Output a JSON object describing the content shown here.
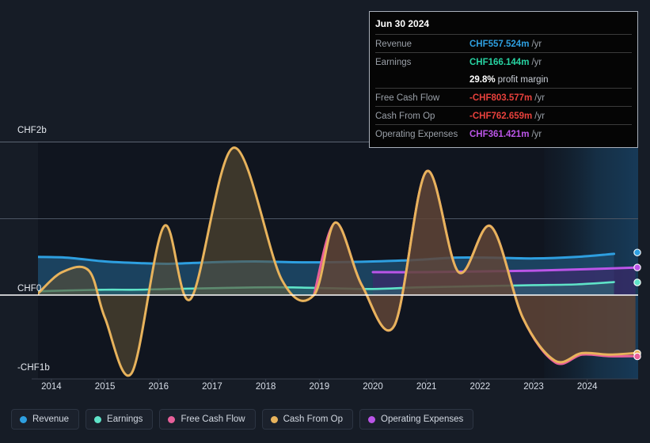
{
  "chart_data": {
    "type": "area",
    "title": "",
    "xlabel": "",
    "ylabel": "",
    "currency": "CHF",
    "grid": true,
    "legend_position": "bottom-left",
    "x_ticks": [
      "2014",
      "2015",
      "2016",
      "2017",
      "2018",
      "2019",
      "2020",
      "2021",
      "2022",
      "2023",
      "2024"
    ],
    "y_ticks": [
      "CHF2b",
      "CHF0",
      "-CHF1b"
    ],
    "ylim": [
      -1.1,
      2.1
    ],
    "y_tick_values": [
      2,
      0,
      -1
    ],
    "gridline_values": [
      2,
      1,
      0
    ],
    "zero_line": 0,
    "forecast_region": {
      "from": "2023.2",
      "to": "2024.9",
      "label": ""
    },
    "series": [
      {
        "name": "Revenue",
        "color": "#2e9fe0",
        "fill": "#1d4a6b",
        "x": [
          2013.75,
          2014.3,
          2015.0,
          2015.6,
          2016.2,
          2017.0,
          2017.8,
          2018.5,
          2019.2,
          2020.0,
          2020.8,
          2021.5,
          2022.2,
          2023.0,
          2023.8,
          2024.5
        ],
        "values": [
          0.5,
          0.49,
          0.44,
          0.42,
          0.41,
          0.43,
          0.44,
          0.43,
          0.43,
          0.44,
          0.46,
          0.49,
          0.49,
          0.48,
          0.5,
          0.54
        ]
      },
      {
        "name": "Earnings",
        "color": "#5fe3c8",
        "fill": "#2f6f75",
        "x": [
          2013.75,
          2014.3,
          2015.0,
          2015.6,
          2016.2,
          2017.0,
          2017.8,
          2018.5,
          2019.2,
          2020.0,
          2020.8,
          2021.5,
          2022.2,
          2023.0,
          2023.8,
          2024.5
        ],
        "values": [
          0.05,
          0.06,
          0.07,
          0.07,
          0.08,
          0.09,
          0.1,
          0.1,
          0.09,
          0.08,
          0.1,
          0.11,
          0.12,
          0.13,
          0.14,
          0.17
        ]
      },
      {
        "name": "Free Cash Flow",
        "color": "#e8609a",
        "fill": "#6b2f40",
        "x": [
          2018.9,
          2019.3,
          2019.8,
          2020.4,
          2021.0,
          2021.6,
          2022.2,
          2022.8,
          2023.4,
          2023.9,
          2024.4,
          2024.9
        ],
        "values": [
          0.0,
          0.95,
          0.12,
          -0.4,
          1.62,
          0.3,
          0.9,
          -0.3,
          -0.88,
          -0.78,
          -0.8,
          -0.8
        ]
      },
      {
        "name": "Cash From Op",
        "color": "#e8b35c",
        "fill": "#5c4e33",
        "x": [
          2013.75,
          2014.2,
          2014.7,
          2015.0,
          2015.5,
          2016.1,
          2016.6,
          2017.4,
          2018.3,
          2018.9,
          2019.3,
          2019.8,
          2020.4,
          2021.0,
          2021.6,
          2022.2,
          2022.8,
          2023.4,
          2023.9,
          2024.4,
          2024.9
        ],
        "values": [
          0.02,
          0.3,
          0.32,
          -0.3,
          -1.02,
          0.9,
          -0.05,
          1.93,
          0.2,
          0.0,
          0.95,
          0.12,
          -0.4,
          1.62,
          0.3,
          0.9,
          -0.3,
          -0.86,
          -0.76,
          -0.78,
          -0.76
        ]
      },
      {
        "name": "Operating Expenses",
        "color": "#bb55e8",
        "fill": "#3c2a6b",
        "x": [
          2020.0,
          2021.0,
          2022.0,
          2023.0,
          2024.0,
          2024.9
        ],
        "values": [
          0.3,
          0.3,
          0.31,
          0.32,
          0.34,
          0.36
        ]
      }
    ],
    "endpoint_markers": [
      {
        "series": "Revenue",
        "color": "#2e9fe0",
        "value": 0.557524
      },
      {
        "series": "Operating Expenses",
        "color": "#bb55e8",
        "value": 0.361421
      },
      {
        "series": "Earnings",
        "color": "#5fe3c8",
        "value": 0.166144
      },
      {
        "series": "Cash From Op",
        "color": "#e8b35c",
        "value": -0.762659
      },
      {
        "series": "Free Cash Flow",
        "color": "#e8609a",
        "value": -0.803577
      }
    ]
  },
  "tooltip": {
    "date": "Jun 30 2024",
    "unit_suffix": "/yr",
    "rows": [
      {
        "label": "Revenue",
        "value": "CHF557.524m",
        "color": "#2e9fe0",
        "unit": "/yr"
      },
      {
        "label": "Earnings",
        "value": "CHF166.144m",
        "color": "#27d3a2",
        "unit": "/yr"
      },
      {
        "label": "",
        "value": "29.8%",
        "color": "#ffffff",
        "sub": "profit margin"
      },
      {
        "label": "Free Cash Flow",
        "value": "-CHF803.577m",
        "color": "#e8413c",
        "unit": "/yr"
      },
      {
        "label": "Cash From Op",
        "value": "-CHF762.659m",
        "color": "#e8413c",
        "unit": "/yr"
      },
      {
        "label": "Operating Expenses",
        "value": "CHF361.421m",
        "color": "#bb55e8",
        "unit": "/yr"
      }
    ]
  },
  "legend": {
    "items": [
      {
        "label": "Revenue",
        "color": "#2e9fe0"
      },
      {
        "label": "Earnings",
        "color": "#5fe3c8"
      },
      {
        "label": "Free Cash Flow",
        "color": "#e8609a"
      },
      {
        "label": "Cash From Op",
        "color": "#e8b35c"
      },
      {
        "label": "Operating Expenses",
        "color": "#bb55e8"
      }
    ]
  },
  "axes": {
    "y_top": "CHF2b",
    "y_zero": "CHF0",
    "y_bottom": "-CHF1b"
  }
}
